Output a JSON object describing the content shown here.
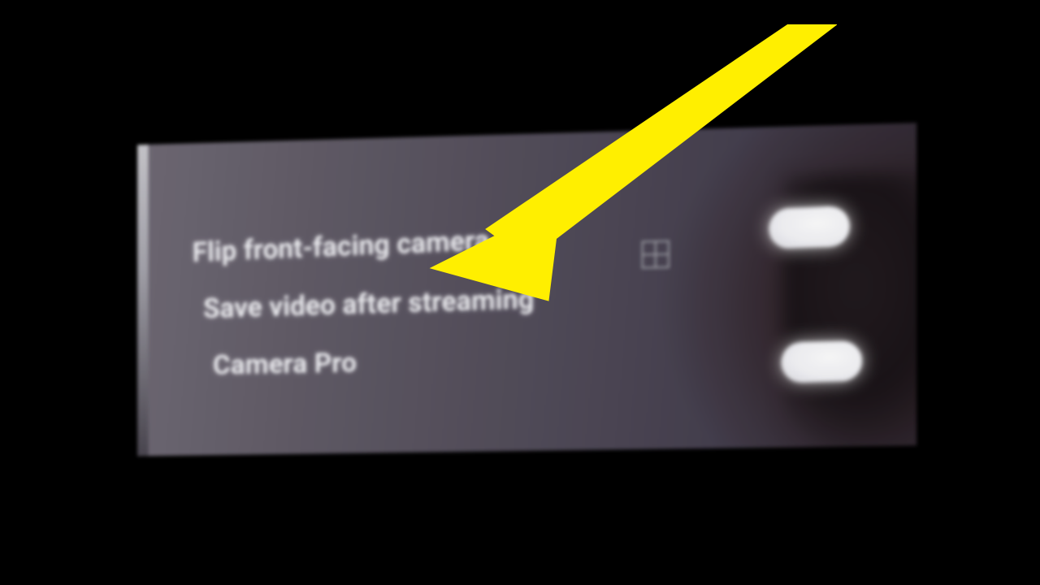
{
  "annotation": {
    "arrow_color": "#ffef00"
  },
  "settings": {
    "rows": [
      {
        "label": "Flip front-facing camera",
        "toggle_on": true
      },
      {
        "label": "Save video after streaming",
        "toggle_on": true
      },
      {
        "label": "Camera Pro"
      }
    ]
  },
  "icons": {
    "grid": "grid-icon"
  }
}
